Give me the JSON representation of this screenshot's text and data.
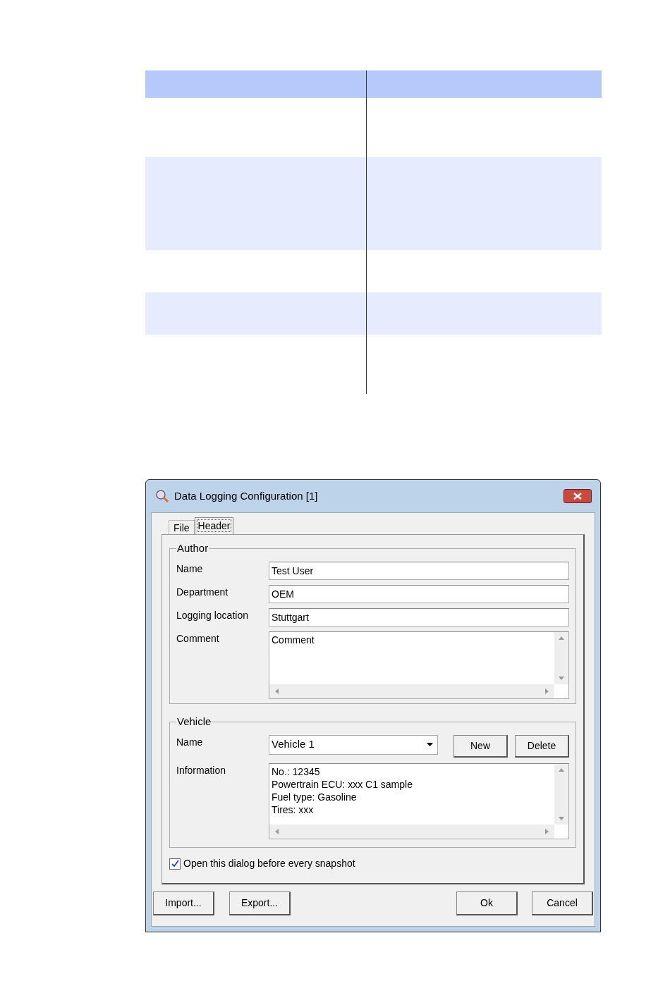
{
  "dialog": {
    "title": "Data Logging Configuration [1]",
    "tabs": [
      {
        "label": "File",
        "selected": false
      },
      {
        "label": "Header",
        "selected": true
      }
    ],
    "author": {
      "legend": "Author",
      "fields": [
        {
          "label": "Name",
          "value": "Test User",
          "kind": "text"
        },
        {
          "label": "Department",
          "value": "OEM",
          "kind": "text"
        },
        {
          "label": "Logging location",
          "value": "Stuttgart",
          "kind": "text"
        },
        {
          "label": "Comment",
          "value": "Comment",
          "kind": "multiline"
        }
      ]
    },
    "vehicle": {
      "legend": "Vehicle",
      "name_label": "Name",
      "name_value": "Vehicle 1",
      "buttons": [
        "New",
        "Delete"
      ],
      "info_label": "Information",
      "info_lines": [
        "No.: 12345",
        "Powertrain ECU: xxx C1 sample",
        "Fuel type: Gasoline",
        "Tires: xxx"
      ]
    },
    "checkbox": {
      "label": "Open this dialog before every snapshot",
      "checked": true
    },
    "left_buttons": [
      "Import...",
      "Export..."
    ],
    "right_buttons": [
      "Ok",
      "Cancel"
    ]
  }
}
